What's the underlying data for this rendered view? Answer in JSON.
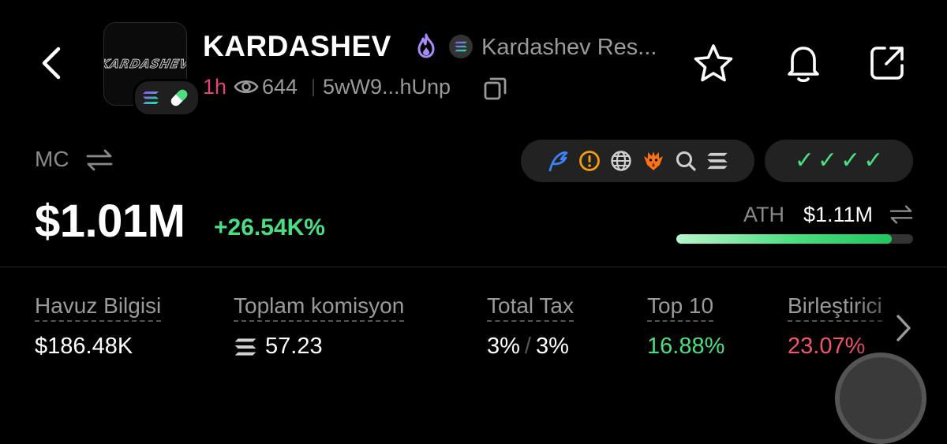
{
  "header": {
    "title": "KARDASHEV",
    "avatar_text": "KARDASHEV",
    "project_name": "Kardashev Res...",
    "age": "1h",
    "views": "644",
    "address": "5wW9...hUnp"
  },
  "market_cap": {
    "label": "MC",
    "value": "$1.01M",
    "change": "+26.54K%"
  },
  "ath": {
    "label": "ATH",
    "value": "$1.11M",
    "progress_fraction": 0.91
  },
  "audit_icons": [
    "feather-icon",
    "warning-icon",
    "globe-icon",
    "eagle-icon",
    "search-icon",
    "solana-icon"
  ],
  "checks": [
    "✓",
    "✓",
    "✓",
    "✓"
  ],
  "stats": [
    {
      "label": "Havuz Bilgisi",
      "value": "$186.48K"
    },
    {
      "label": "Toplam komisyon",
      "value": "57.23"
    },
    {
      "label": "Total Tax",
      "value_a": "3%",
      "value_b": "3%"
    },
    {
      "label": "Top 10",
      "value": "16.88%"
    },
    {
      "label": "Birleştirici",
      "value": "23.07%"
    }
  ],
  "colors": {
    "accent_green": "#4ade80",
    "accent_pink": "#e0447a",
    "accent_red": "#f0556b",
    "background": "#000000"
  }
}
